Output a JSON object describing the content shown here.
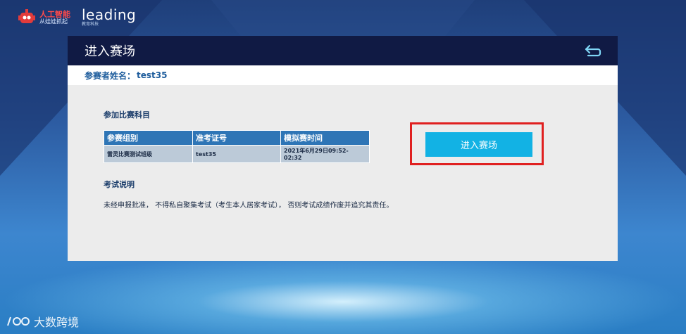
{
  "brand": {
    "robot_title": "人工智能",
    "robot_sub": "从娃娃抓起",
    "leading_name": "leading",
    "leading_sub": "教育科技"
  },
  "panel": {
    "title": "进入赛场",
    "back_icon": "return-arrow-icon",
    "user_label": "参赛者姓名：",
    "user_value": "test35"
  },
  "subjects": {
    "title": "参加比赛科目",
    "columns": [
      "参赛组别",
      "准考证号",
      "模拟赛时间"
    ],
    "rows": [
      [
        "雷灵比赛测试班级",
        "test35",
        "2021年6月29日09:52-02:32"
      ]
    ]
  },
  "enter_button": {
    "label": "进入赛场",
    "accent": "#12b2e4",
    "highlight": "#e02020"
  },
  "instructions": {
    "title": "考试说明",
    "text": "未经申报批准， 不得私自聚集考试（考生本人居家考试）， 否则考试成绩作废并追究其责任。"
  },
  "watermark": {
    "text": "大数跨境"
  }
}
